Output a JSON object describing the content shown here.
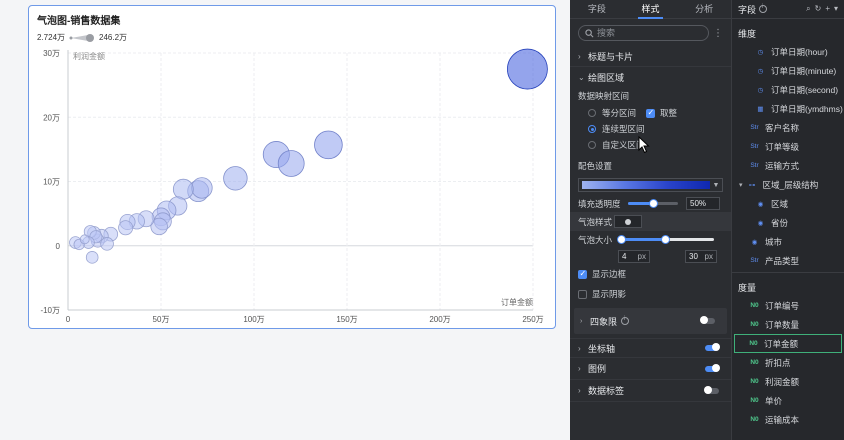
{
  "chart_card": {
    "title": "气泡图-销售数据集",
    "size_legend": {
      "min": "2.724万",
      "max": "246.2万"
    }
  },
  "chart_data": {
    "type": "scatter",
    "title": "气泡图-销售数据集",
    "xlabel": "订单金额",
    "ylabel": "利润金额",
    "xlim": [
      0,
      2500000
    ],
    "ylim": [
      -100000,
      300000
    ],
    "x_ticks": [
      0,
      500000,
      1000000,
      1500000,
      2000000,
      2500000
    ],
    "x_tick_labels": [
      "0",
      "50万",
      "100万",
      "150万",
      "200万",
      "250万"
    ],
    "y_ticks": [
      -100000,
      0,
      100000,
      200000,
      300000
    ],
    "y_tick_labels": [
      "-10万",
      "0",
      "10万",
      "20万",
      "30万"
    ],
    "size_range": [
      27240,
      2462000
    ],
    "grid": true,
    "points": [
      {
        "x": 2470000,
        "y": 275000,
        "size": 2462000
      },
      {
        "x": 1400000,
        "y": 157000,
        "size": 950000
      },
      {
        "x": 1120000,
        "y": 142000,
        "size": 820000
      },
      {
        "x": 1200000,
        "y": 128000,
        "size": 800000
      },
      {
        "x": 900000,
        "y": 105000,
        "size": 600000
      },
      {
        "x": 700000,
        "y": 85000,
        "size": 430000
      },
      {
        "x": 720000,
        "y": 90000,
        "size": 400000
      },
      {
        "x": 620000,
        "y": 88000,
        "size": 370000
      },
      {
        "x": 590000,
        "y": 62000,
        "size": 280000
      },
      {
        "x": 530000,
        "y": 55000,
        "size": 300000
      },
      {
        "x": 500000,
        "y": 45000,
        "size": 260000
      },
      {
        "x": 510000,
        "y": 38000,
        "size": 220000
      },
      {
        "x": 490000,
        "y": 30000,
        "size": 200000
      },
      {
        "x": 420000,
        "y": 42000,
        "size": 180000
      },
      {
        "x": 370000,
        "y": 38000,
        "size": 160000
      },
      {
        "x": 320000,
        "y": 37000,
        "size": 150000
      },
      {
        "x": 310000,
        "y": 28000,
        "size": 120000
      },
      {
        "x": 230000,
        "y": 18000,
        "size": 110000
      },
      {
        "x": 180000,
        "y": 15000,
        "size": 100000
      },
      {
        "x": 160000,
        "y": 8000,
        "size": 90000
      },
      {
        "x": 210000,
        "y": 3000,
        "size": 80000
      },
      {
        "x": 140000,
        "y": 20000,
        "size": 80000
      },
      {
        "x": 120000,
        "y": 22000,
        "size": 70000
      },
      {
        "x": 150000,
        "y": 14000,
        "size": 70000
      },
      {
        "x": 110000,
        "y": 5000,
        "size": 60000
      },
      {
        "x": 130000,
        "y": -18000,
        "size": 60000
      },
      {
        "x": 40000,
        "y": 5000,
        "size": 60000
      },
      {
        "x": 60000,
        "y": 2000,
        "size": 40000
      },
      {
        "x": 90000,
        "y": 10000,
        "size": 30000
      }
    ]
  },
  "style_panel": {
    "tabs": [
      "字段",
      "样式",
      "分析"
    ],
    "active_tab": 1,
    "search_placeholder": "搜索",
    "sections": {
      "title_card": "标题与卡片",
      "plot_area": "绘图区域",
      "axis": "坐标轴",
      "legend": "图例",
      "data_label": "数据标签",
      "quadrant": "四象限"
    },
    "mapping": {
      "label": "数据映射区间",
      "equal": "等分区间",
      "round": "取整",
      "continuous": "连续型区间",
      "custom": "自定义区间"
    },
    "color_label": "配色设置",
    "accent": "#4d8cf5",
    "opacity": {
      "label": "填充透明度",
      "value": "50%",
      "level": 0.5
    },
    "bubble_style_label": "气泡样式",
    "bubble_size": {
      "label": "气泡大小",
      "min": "4",
      "max": "30",
      "unit": "px"
    },
    "show_border": "显示边框",
    "show_shadow": "显示阴影"
  },
  "field_panel": {
    "title": "字段",
    "dimension_title": "维度",
    "dimensions": [
      {
        "label": "订单日期(hour)",
        "icon": "hour-icon",
        "indent": true
      },
      {
        "label": "订单日期(minute)",
        "icon": "minute-icon",
        "indent": true
      },
      {
        "label": "订单日期(second)",
        "icon": "second-icon",
        "indent": true
      },
      {
        "label": "订单日期(ymdhms)",
        "icon": "calendar-icon",
        "indent": true
      },
      {
        "label": "客户名称",
        "icon": "text-field-icon",
        "indent": false
      },
      {
        "label": "订单等级",
        "icon": "text-field-icon",
        "indent": false
      },
      {
        "label": "运输方式",
        "icon": "text-field-icon",
        "indent": false
      },
      {
        "label": "区域_层级结构",
        "icon": "hierarchy-icon",
        "indent": false
      },
      {
        "label": "区域",
        "icon": "location-icon",
        "indent": true
      },
      {
        "label": "省份",
        "icon": "location-icon",
        "indent": true
      },
      {
        "label": "城市",
        "icon": "location-icon",
        "indent": false
      },
      {
        "label": "产品类型",
        "icon": "text-field-icon",
        "indent": false
      }
    ],
    "measure_title": "度量",
    "measures": [
      {
        "label": "订单编号"
      },
      {
        "label": "订单数量"
      },
      {
        "label": "订单金额",
        "selected": true
      },
      {
        "label": "折扣点"
      },
      {
        "label": "利润金额"
      },
      {
        "label": "单价"
      },
      {
        "label": "运输成本"
      }
    ]
  }
}
